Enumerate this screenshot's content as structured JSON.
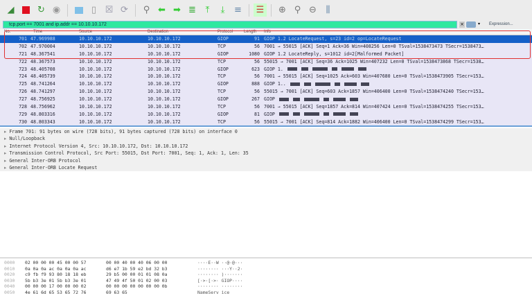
{
  "toolbar": {
    "icons": [
      "shark-fin-start-icon",
      "stop-icon",
      "restart-icon",
      "options-gear-icon",
      "open-file-icon",
      "save-file-icon",
      "close-file-icon",
      "reload-icon",
      "find-icon",
      "back-arrow-icon",
      "forward-arrow-icon",
      "go-to-packet-icon",
      "first-packet-icon",
      "last-packet-icon",
      "autoscroll-icon",
      "colorize-icon",
      "zoom-in-icon",
      "zoom-out-icon",
      "zoom-normal-icon",
      "resize-columns-icon"
    ]
  },
  "filter": {
    "value": "tcp.port == 7001 and ip.addr == 10.10.10.172",
    "expression_label": "Expression...",
    "accent": "#2ee8a0"
  },
  "columns": [
    "No.",
    "Time",
    "Source",
    "Destination",
    "Protocol",
    "Length",
    "Info"
  ],
  "packets": [
    {
      "no": "701",
      "time": "47.969988",
      "src": "10.10.10.172",
      "dst": "10.10.10.172",
      "proto": "GIOP",
      "len": "91",
      "info": "GIOP 1.2 LocateRequest, s=23 id=2 op=LocateRequest",
      "selected": true
    },
    {
      "no": "702",
      "time": "47.970004",
      "src": "10.10.10.172",
      "dst": "10.10.10.172",
      "proto": "TCP",
      "len": "56",
      "info": "7001 → 55015 [ACK] Seq=1 Ack=36 Win=408256 Len=0 TSval=1538473473 TSecr=1538473…"
    },
    {
      "no": "721",
      "time": "48.367541",
      "src": "10.10.10.172",
      "dst": "10.10.10.172",
      "proto": "GIOP",
      "len": "1080",
      "info": "GIOP 1.2 LocateReply, s=1012 id=2[Malformed Packet]"
    },
    {
      "no": "722",
      "time": "48.367573",
      "src": "10.10.10.172",
      "dst": "10.10.10.172",
      "proto": "TCP",
      "len": "56",
      "info": "55015 → 7001 [ACK] Seq=36 Ack=1025 Win=407232 Len=0 TSval=1538473868 TSecr=1538…"
    },
    {
      "no": "723",
      "time": "48.405708",
      "src": "10.10.10.172",
      "dst": "10.10.10.172",
      "proto": "GIOP",
      "len": "623",
      "info": "GIOP 1.",
      "redacted": true
    },
    {
      "no": "724",
      "time": "48.405739",
      "src": "10.10.10.172",
      "dst": "10.10.10.172",
      "proto": "TCP",
      "len": "56",
      "info": "7001 → 55015 [ACK] Seq=1025 Ack=603 Win=407680 Len=0 TSval=1538473905 TSecr=153…"
    },
    {
      "no": "725",
      "time": "48.741264",
      "src": "10.10.10.172",
      "dst": "10.10.10.172",
      "proto": "GIOP",
      "len": "888",
      "info": "GIOP 1..",
      "redacted": true
    },
    {
      "no": "726",
      "time": "48.741297",
      "src": "10.10.10.172",
      "dst": "10.10.10.172",
      "proto": "TCP",
      "len": "56",
      "info": "55015 → 7001 [ACK] Seq=603 Ack=1857 Win=406400 Len=0 TSval=1538474240 TSecr=153…"
    },
    {
      "no": "727",
      "time": "48.756925",
      "src": "10.10.10.172",
      "dst": "10.10.10.172",
      "proto": "GIOP",
      "len": "267",
      "info": "GIOP",
      "redacted": true
    },
    {
      "no": "728",
      "time": "48.756962",
      "src": "10.10.10.172",
      "dst": "10.10.10.172",
      "proto": "TCP",
      "len": "56",
      "info": "7001 → 55015 [ACK] Seq=1857 Ack=814 Win=407424 Len=0 TSval=1538474255 TSecr=153…"
    },
    {
      "no": "729",
      "time": "48.803316",
      "src": "10.10.10.172",
      "dst": "10.10.10.172",
      "proto": "GIOP",
      "len": "81",
      "info": "GIOP",
      "redacted": true
    },
    {
      "no": "730",
      "time": "48.803343",
      "src": "10.10.10.172",
      "dst": "10.10.10.172",
      "proto": "TCP",
      "len": "56",
      "info": "55015 → 7001 [ACK] Seq=814 Ack=1882 Win=406400 Len=0 TSval=1538474299 TSecr=153…"
    }
  ],
  "details": [
    "Frame 701: 91 bytes on wire (728 bits), 91 bytes captured (728 bits) on interface 0",
    "Null/Loopback",
    "Internet Protocol Version 4, Src: 10.10.10.172, Dst: 10.10.10.172",
    "Transmission Control Protocol, Src Port: 55015, Dst Port: 7001, Seq: 1, Ack: 1, Len: 35",
    "General Inter-ORB Protocol",
    "General Inter-ORB Locate Request"
  ],
  "hex": [
    {
      "off": "0000",
      "b1": "02 00 00 00 45 00 00 57",
      "b2": "00 00 40 00 40 06 00 00",
      "asc": "····E··W ··@·@···"
    },
    {
      "off": "0010",
      "b1": "0a 0a 0a ac 0a 0a 0a ac",
      "b2": "d6 e7 1b 59 e2 bd 32 b3",
      "asc": "········ ···Y··2·"
    },
    {
      "off": "0020",
      "b1": "c9 fb f9 93 80 18 18 eb",
      "b2": "29 b5 00 00 01 01 08 0a",
      "asc": "········ )·······"
    },
    {
      "off": "0030",
      "b1": "5b b3 3e 01 5b b3 3e 01",
      "b2": "47 49 4f 50 01 02 00 03",
      "asc": "[·>·[·>· GIOP····"
    },
    {
      "off": "0040",
      "b1": "00 00 00 17 00 00 00 02",
      "b2": "00 00 00 00 00 00 00 0b",
      "asc": "········ ········"
    },
    {
      "off": "0050",
      "b1": "4e 61 6d 65 53 65 72 76",
      "b2": "69 63 65",
      "asc": "NameServ ice"
    }
  ]
}
